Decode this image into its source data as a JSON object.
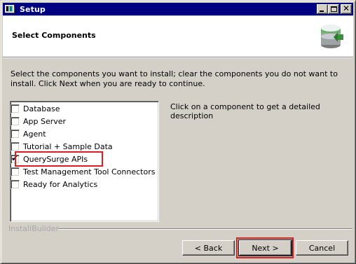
{
  "window": {
    "title": "Setup"
  },
  "titlebar": {
    "minimize_icon": "minimize-icon",
    "maximize_icon": "maximize-icon",
    "close_glyph": "✕"
  },
  "header": {
    "title": "Select Components",
    "icon": "installer-database-icon"
  },
  "instructions": "Select the components you want to install; clear the components you do not want to install. Click Next when you are ready to continue.",
  "components": {
    "items": [
      {
        "label": "Database",
        "checked": false
      },
      {
        "label": "App Server",
        "checked": false
      },
      {
        "label": "Agent",
        "checked": false
      },
      {
        "label": "Tutorial + Sample Data",
        "checked": false
      },
      {
        "label": "QuerySurge APIs",
        "checked": true
      },
      {
        "label": "Test Management Tool Connectors",
        "checked": false
      },
      {
        "label": "Ready for Analytics",
        "checked": false
      }
    ],
    "check_glyph": "✔"
  },
  "description": "Click on a component to get a detailed description",
  "footer": {
    "brand": "InstallBuilder"
  },
  "buttons": {
    "back": "< Back",
    "next": "Next >",
    "cancel": "Cancel"
  },
  "colors": {
    "titlebar": "#000080",
    "highlight": "#d81e1e",
    "face": "#d4d0c8"
  }
}
